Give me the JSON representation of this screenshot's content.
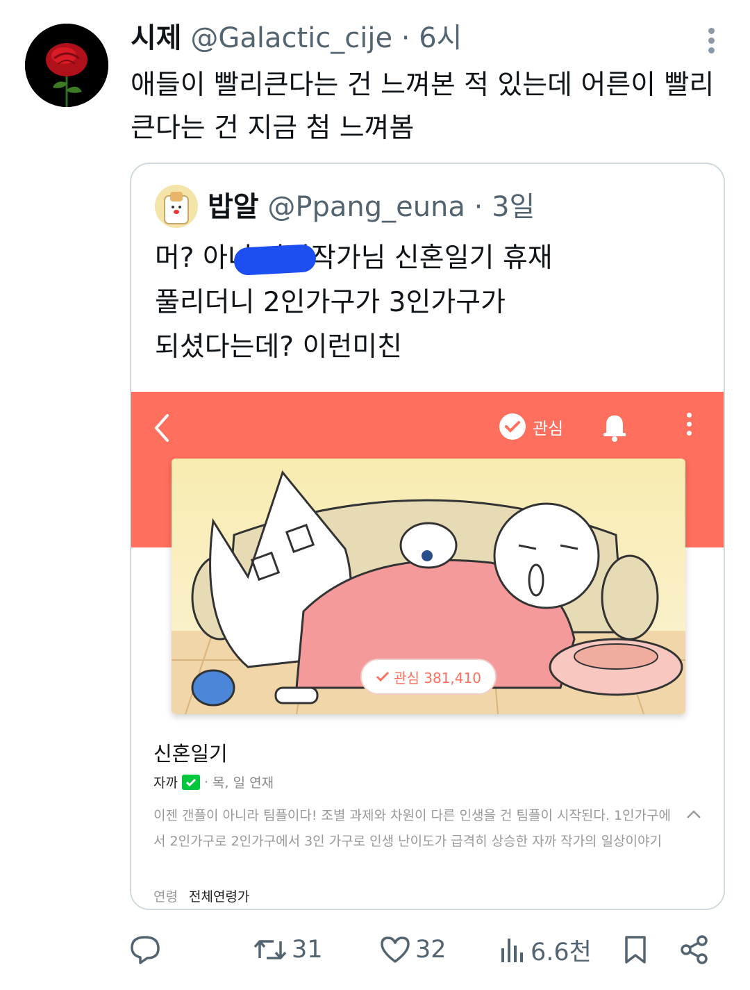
{
  "tweet": {
    "author_name": "시제",
    "author_handle": "@Galactic_cije",
    "dot": "·",
    "time": "6시",
    "text": "애들이 빨리큰다는 건 느껴본 적 있는데 어른이 빨리큰다는 건 지금 첨 느껴봄"
  },
  "quote": {
    "author_name": "밥알",
    "author_handle": "@Ppang_euna",
    "dot": "·",
    "time": "3일",
    "text_line1": "머? 아너 자까작가님 신혼일기 휴재",
    "text_line2": "풀리더니 2인가구가 3인가구가",
    "text_line3": "되셨다는데? 이런미친"
  },
  "webtoon": {
    "favorite_label": "관심",
    "favorite_pill": "관심 381,410",
    "title": "신혼일기",
    "author": "자까",
    "separator": "·",
    "schedule": "목, 일 연재",
    "description": "이젠 갠플이 아니라 팀플이다! 조별 과제와 차원이 다른 인생을 건 팀플이 시작된다. 1인가구에서 2인가구로 2인가구에서 3인 가구로 인생 난이도가 급격히 상승한 자까 작가의 일상이야기",
    "age_label": "연령",
    "age_value": "전체연령가",
    "band_color": "#ff6f5d",
    "badge_color": "#00c73c"
  },
  "actions": {
    "reply_icon": "reply-icon",
    "retweets": "31",
    "likes": "32",
    "views": "6.6천",
    "bookmark_icon": "bookmark-icon",
    "share_icon": "share-icon"
  }
}
